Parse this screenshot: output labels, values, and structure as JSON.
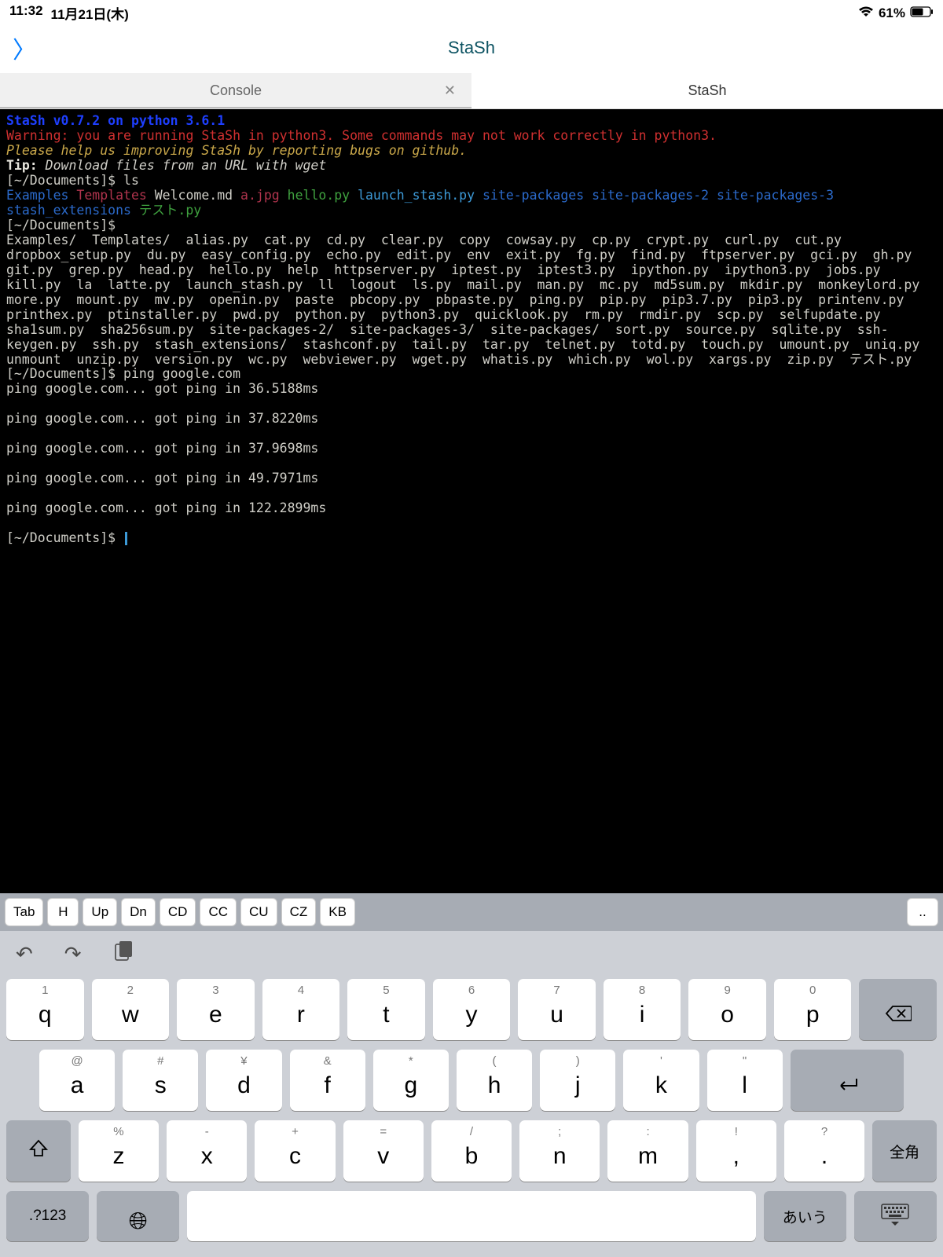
{
  "status": {
    "time": "11:32",
    "date": "11月21日(木)",
    "battery": "61%"
  },
  "nav": {
    "title": "StaSh"
  },
  "tabs": {
    "console": "Console",
    "stash": "StaSh"
  },
  "term": {
    "banner": "StaSh v0.7.2 on python 3.6.1",
    "warning": "Warning: you are running StaSh in python3. Some commands may not work correctly in python3.",
    "help": "Please help us improving StaSh by reporting bugs on github.",
    "tip_label": "Tip:",
    "tip_text": " Download files from an URL with wget",
    "prompt": "[~/Documents]$ ",
    "cmd1": "ls",
    "ls1_examples": "Examples ",
    "ls1_templates": "Templates ",
    "ls1_welcome": "Welcome.md ",
    "ls1_ajpg": "a.jpg ",
    "ls1_hello": "hello.py ",
    "ls1_launch": "launch_stash.py ",
    "ls1_site": "site-packages site-packages-2 site-packages-3 stash_extensions ",
    "ls1_test": "テスト.py",
    "cmd2": "",
    "ls2": "Examples/  Templates/  alias.py  cat.py  cd.py  clear.py  copy  cowsay.py  cp.py  crypt.py  curl.py  cut.py  dropbox_setup.py  du.py  easy_config.py  echo.py  edit.py  env  exit.py  fg.py  find.py  ftpserver.py  gci.py  gh.py  git.py  grep.py  head.py  hello.py  help  httpserver.py  iptest.py  iptest3.py  ipython.py  ipython3.py  jobs.py  kill.py  la  latte.py  launch_stash.py  ll  logout  ls.py  mail.py  man.py  mc.py  md5sum.py  mkdir.py  monkeylord.py  more.py  mount.py  mv.py  openin.py  paste  pbcopy.py  pbpaste.py  ping.py  pip.py  pip3.7.py  pip3.py  printenv.py  printhex.py  ptinstaller.py  pwd.py  python.py  python3.py  quicklook.py  rm.py  rmdir.py  scp.py  selfupdate.py  sha1sum.py  sha256sum.py  site-packages-2/  site-packages-3/  site-packages/  sort.py  source.py  sqlite.py  ssh-keygen.py  ssh.py  stash_extensions/  stashconf.py  tail.py  tar.py  telnet.py  totd.py  touch.py  umount.py  uniq.py  unmount  unzip.py  version.py  wc.py  webviewer.py  wget.py  whatis.py  which.py  wol.py  xargs.py  zip.py  テスト.py",
    "cmd3": "ping google.com",
    "ping1": "ping google.com... got ping in 36.5188ms",
    "ping2": "ping google.com... got ping in 37.8220ms",
    "ping3": "ping google.com... got ping in 37.9698ms",
    "ping4": "ping google.com... got ping in 49.7971ms",
    "ping5": "ping google.com... got ping in 122.2899ms"
  },
  "extkeys": {
    "tab": "Tab",
    "h": "H",
    "up": "Up",
    "dn": "Dn",
    "cd": "CD",
    "cc": "CC",
    "cu": "CU",
    "cz": "CZ",
    "kb": "KB",
    "more": ".."
  },
  "kb": {
    "row1": [
      {
        "sub": "1",
        "main": "q"
      },
      {
        "sub": "2",
        "main": "w"
      },
      {
        "sub": "3",
        "main": "e"
      },
      {
        "sub": "4",
        "main": "r"
      },
      {
        "sub": "5",
        "main": "t"
      },
      {
        "sub": "6",
        "main": "y"
      },
      {
        "sub": "7",
        "main": "u"
      },
      {
        "sub": "8",
        "main": "i"
      },
      {
        "sub": "9",
        "main": "o"
      },
      {
        "sub": "0",
        "main": "p"
      }
    ],
    "row2": [
      {
        "sub": "@",
        "main": "a"
      },
      {
        "sub": "#",
        "main": "s"
      },
      {
        "sub": "¥",
        "main": "d"
      },
      {
        "sub": "&",
        "main": "f"
      },
      {
        "sub": "*",
        "main": "g"
      },
      {
        "sub": "(",
        "main": "h"
      },
      {
        "sub": ")",
        "main": "j"
      },
      {
        "sub": "'",
        "main": "k"
      },
      {
        "sub": "\"",
        "main": "l"
      }
    ],
    "row3": [
      {
        "sub": "%",
        "main": "z"
      },
      {
        "sub": "-",
        "main": "x"
      },
      {
        "sub": "+",
        "main": "c"
      },
      {
        "sub": "=",
        "main": "v"
      },
      {
        "sub": "/",
        "main": "b"
      },
      {
        "sub": ";",
        "main": "n"
      },
      {
        "sub": ":",
        "main": "m"
      },
      {
        "sub": "!",
        "main": ","
      },
      {
        "sub": "?",
        "main": "."
      }
    ],
    "numkey": ".?123",
    "zenkaku": "全角",
    "aiu": "あいう"
  }
}
